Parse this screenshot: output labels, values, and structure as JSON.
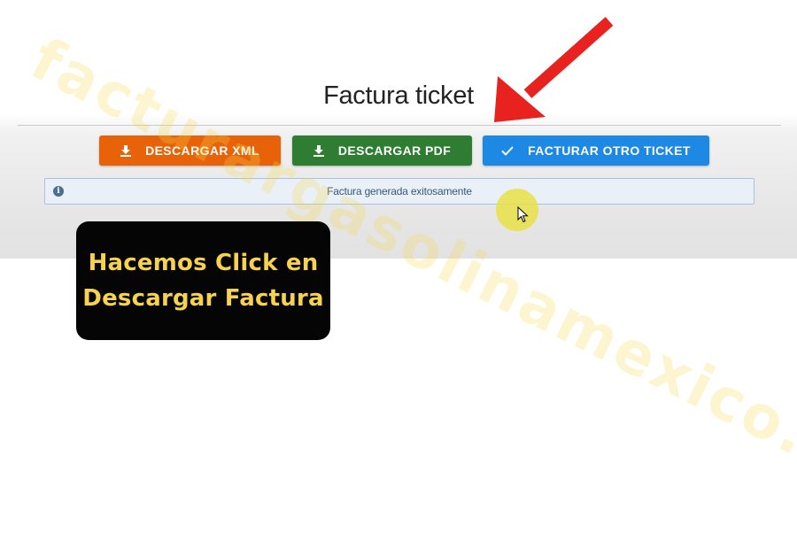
{
  "page": {
    "title": "Factura ticket"
  },
  "actions": {
    "download_xml": {
      "label": "DESCARGAR XML",
      "icon": "download-icon",
      "color": "#e8620a"
    },
    "download_pdf": {
      "label": "DESCARGAR PDF",
      "icon": "download-icon",
      "color": "#2e7d32"
    },
    "facturar_otro": {
      "label": "FACTURAR OTRO TICKET",
      "icon": "check-icon",
      "color": "#1e88e5"
    }
  },
  "alert": {
    "icon": "info-icon",
    "message": "Factura generada exitosamente"
  },
  "overlay": {
    "caption_line1": "Hacemos Click en",
    "caption_line2": "Descargar Factura",
    "watermark": "facturargasolinamexico.com",
    "arrow_color": "#e8221f",
    "caption_text_color": "#f7d24c"
  }
}
